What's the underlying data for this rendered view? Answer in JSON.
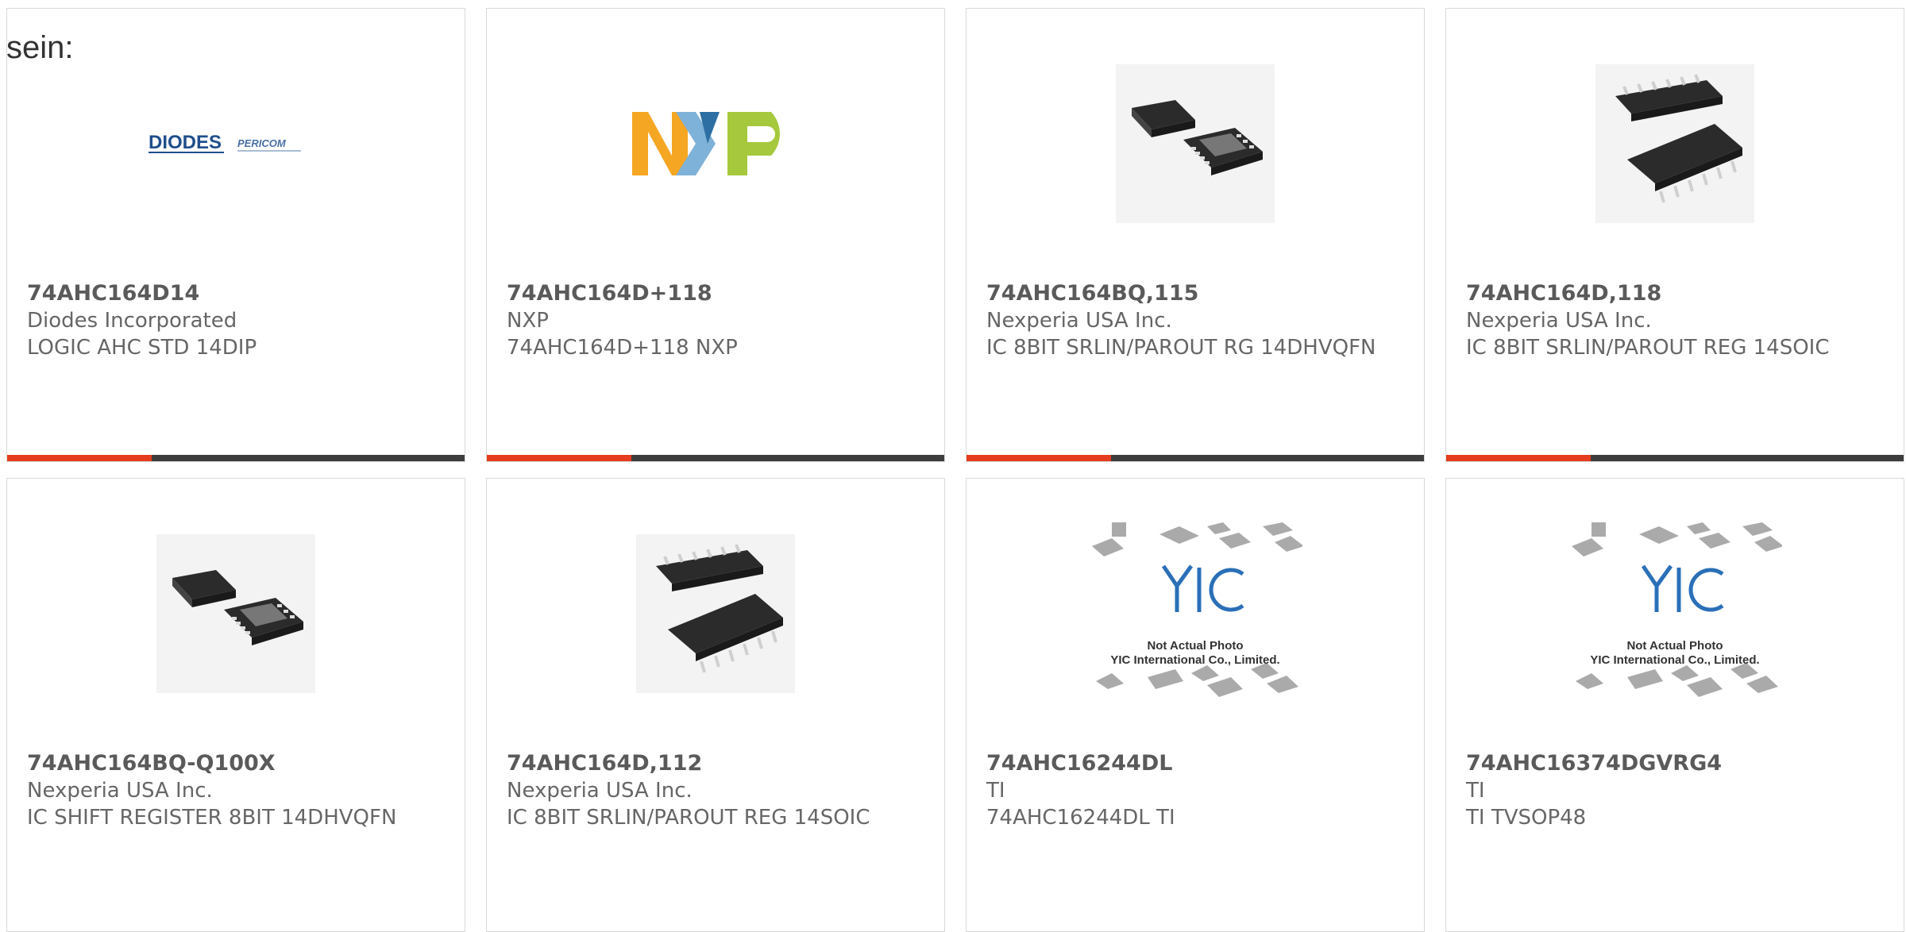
{
  "page": {
    "prefix_text": "sein:"
  },
  "cards": [
    {
      "part_number": "74AHC164D14",
      "manufacturer": "Diodes Incorporated",
      "description": "LOGIC AHC STD 14DIP",
      "image": "diodes-pericom-logo",
      "logo_text_main": "DIODES",
      "logo_text_sub": "PERICOM"
    },
    {
      "part_number": "74AHC164D+118",
      "manufacturer": "NXP",
      "description": "74AHC164D+118 NXP",
      "image": "nxp-logo"
    },
    {
      "part_number": "74AHC164BQ,115",
      "manufacturer": "Nexperia USA Inc.",
      "description": "IC 8BIT SRLIN/PAROUT RG 14DHVQFN",
      "image": "dhvqfn-chip-photo"
    },
    {
      "part_number": "74AHC164D,118",
      "manufacturer": "Nexperia USA Inc.",
      "description": "IC 8BIT SRLIN/PAROUT REG 14SOIC",
      "image": "soic-chip-photo"
    },
    {
      "part_number": "74AHC164BQ-Q100X",
      "manufacturer": "Nexperia USA Inc.",
      "description": "IC SHIFT REGISTER 8BIT 14DHVQFN",
      "image": "dhvqfn-chip-photo"
    },
    {
      "part_number": "74AHC164D,112",
      "manufacturer": "Nexperia USA Inc.",
      "description": "IC 8BIT SRLIN/PAROUT REG 14SOIC",
      "image": "soic-chip-photo"
    },
    {
      "part_number": "74AHC16244DL",
      "manufacturer": "TI",
      "description": "74AHC16244DL TI",
      "image": "yic-placeholder",
      "placeholder_line1": "Not Actual Photo",
      "placeholder_line2": "YIC International Co., Limited."
    },
    {
      "part_number": "74AHC16374DGVRG4",
      "manufacturer": "TI",
      "description": "TI TVSOP48",
      "image": "yic-placeholder",
      "placeholder_line1": "Not Actual Photo",
      "placeholder_line2": "YIC International Co., Limited."
    }
  ],
  "colors": {
    "accent": "#e63d1e",
    "bar": "#3d3d3d",
    "border": "#d9d9d9"
  }
}
